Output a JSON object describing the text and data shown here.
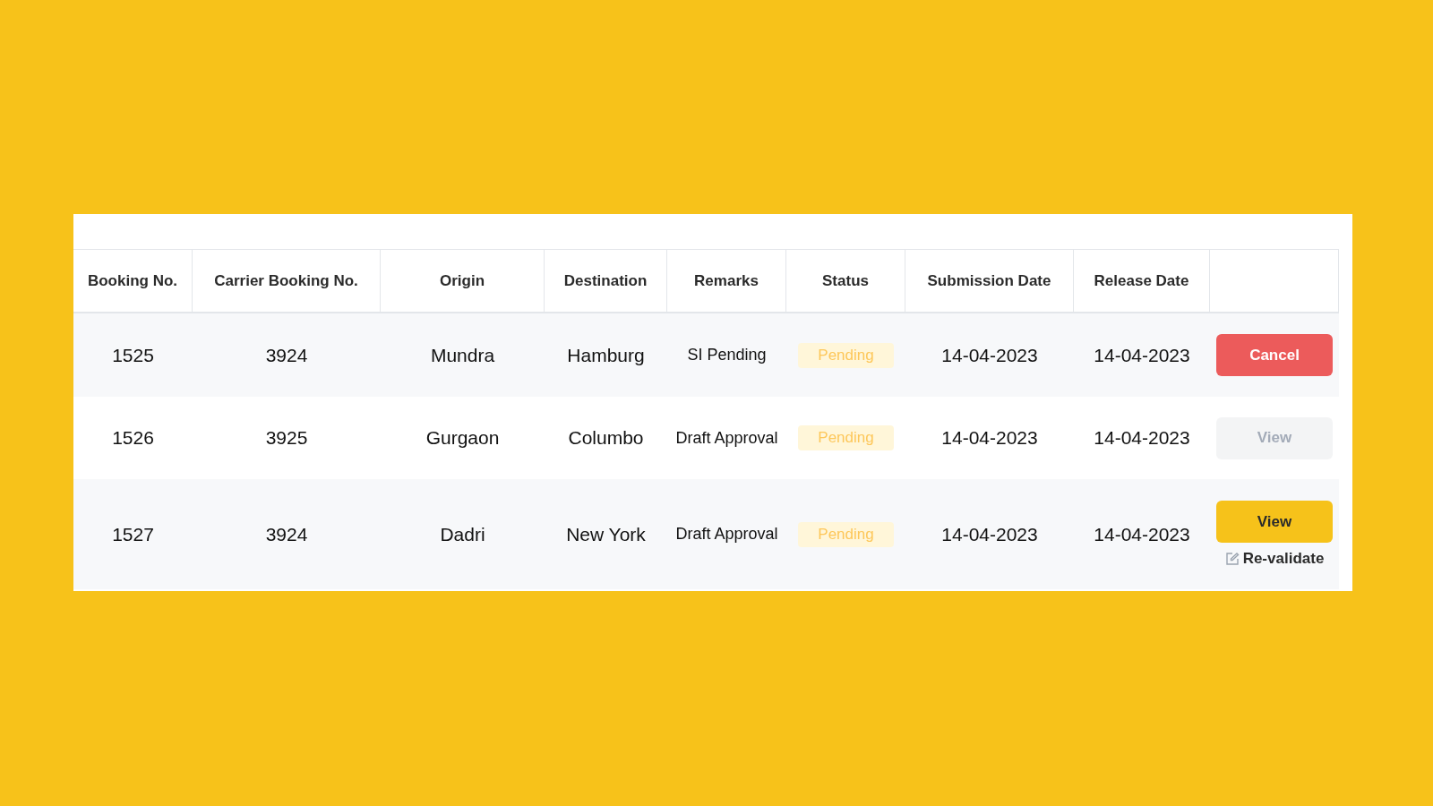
{
  "table": {
    "columns": [
      "Booking No.",
      "Carrier Booking No.",
      "Origin",
      "Destination",
      "Remarks",
      "Status",
      "Submission Date",
      "Release Date"
    ],
    "rows": [
      {
        "booking_no": "1525",
        "carrier_booking_no": "3924",
        "origin": "Mundra",
        "destination": "Hamburg",
        "remarks": "SI Pending",
        "status": "Pending",
        "submission_date": "14-04-2023",
        "release_date": "14-04-2023",
        "action": {
          "kind": "cancel",
          "label": "Cancel",
          "disabled": false
        }
      },
      {
        "booking_no": "1526",
        "carrier_booking_no": "3925",
        "origin": "Gurgaon",
        "destination": "Columbo",
        "remarks": "Draft Approval",
        "status": "Pending",
        "submission_date": "14-04-2023",
        "release_date": "14-04-2023",
        "action": {
          "kind": "view",
          "label": "View",
          "disabled": true
        }
      },
      {
        "booking_no": "1527",
        "carrier_booking_no": "3924",
        "origin": "Dadri",
        "destination": "New York",
        "remarks": "Draft Approval",
        "status": "Pending",
        "submission_date": "14-04-2023",
        "release_date": "14-04-2023",
        "action": {
          "kind": "view",
          "label": "View",
          "disabled": false
        },
        "link": "Re-validate"
      }
    ]
  }
}
